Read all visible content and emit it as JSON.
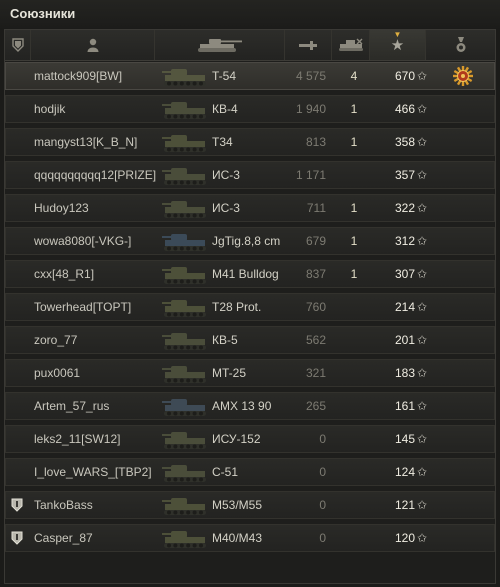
{
  "panel": {
    "title": "Союзники"
  },
  "header": {
    "columns": [
      {
        "id": "squad",
        "icon": "squad-shield-icon"
      },
      {
        "id": "player",
        "icon": "player-icon"
      },
      {
        "id": "vehicle",
        "icon": "tank-icon"
      },
      {
        "id": "damage",
        "icon": "damage-icon"
      },
      {
        "id": "frags",
        "icon": "frags-icon"
      },
      {
        "id": "xp",
        "icon": "star-icon",
        "sorted": true
      },
      {
        "id": "medal",
        "icon": "medal-icon"
      }
    ],
    "star_glyph": "★"
  },
  "star_glyph": "✩",
  "players": [
    {
      "name": "mattock909[BW]",
      "vehicle": "T-54",
      "damage": "4 575",
      "frags": "4",
      "xp": "670",
      "medal": true,
      "me": true,
      "tank_color": "#54563f"
    },
    {
      "name": "hodjik",
      "vehicle": "КВ-4",
      "damage": "1 940",
      "frags": "1",
      "xp": "466",
      "tank_color": "#4a4d3a"
    },
    {
      "name": "mangyst13[K_B_N]",
      "vehicle": "T34",
      "damage": "813",
      "frags": "1",
      "xp": "358",
      "tank_color": "#4d5039"
    },
    {
      "name": "qqqqqqqqqq12[PRIZE]",
      "vehicle": "ИС-3",
      "damage": "1 171",
      "frags": "",
      "xp": "357",
      "tank_color": "#4a4d3a"
    },
    {
      "name": "Hudoy123",
      "vehicle": "ИС-3",
      "damage": "711",
      "frags": "1",
      "xp": "322",
      "tank_color": "#4a4d3a"
    },
    {
      "name": "wowa8080[-VKG-]",
      "vehicle": "JgTig.8,8 cm",
      "damage": "679",
      "frags": "1",
      "xp": "312",
      "tank_color": "#3b4a58"
    },
    {
      "name": "cxx[48_R1]",
      "vehicle": "M41 Bulldog",
      "damage": "837",
      "frags": "1",
      "xp": "307",
      "tank_color": "#4d5039"
    },
    {
      "name": "Towerhead[TOPT]",
      "vehicle": "T28 Prot.",
      "damage": "760",
      "frags": "",
      "xp": "214",
      "tank_color": "#4d5039"
    },
    {
      "name": "zoro_77",
      "vehicle": "КВ-5",
      "damage": "562",
      "frags": "",
      "xp": "201",
      "tank_color": "#4a4d3a"
    },
    {
      "name": "pux0061",
      "vehicle": "MT-25",
      "damage": "321",
      "frags": "",
      "xp": "183",
      "tank_color": "#4a4d3a"
    },
    {
      "name": "Artem_57_rus",
      "vehicle": "AMX 13 90",
      "damage": "265",
      "frags": "",
      "xp": "161",
      "tank_color": "#3e4a55"
    },
    {
      "name": "leks2_11[SW12]",
      "vehicle": "ИСУ-152",
      "damage": "0",
      "frags": "",
      "xp": "145",
      "tank_color": "#4a4d3a"
    },
    {
      "name": "I_love_WARS_[TBP2]",
      "vehicle": "C-51",
      "damage": "0",
      "frags": "",
      "xp": "124",
      "tank_color": "#4a4d3a"
    },
    {
      "name": "TankoBass",
      "vehicle": "M53/M55",
      "damage": "0",
      "frags": "",
      "xp": "121",
      "squad": true,
      "tank_color": "#4d5039"
    },
    {
      "name": "Casper_87",
      "vehicle": "M40/M43",
      "damage": "0",
      "frags": "",
      "xp": "120",
      "squad": true,
      "tank_color": "#4d5039"
    }
  ]
}
